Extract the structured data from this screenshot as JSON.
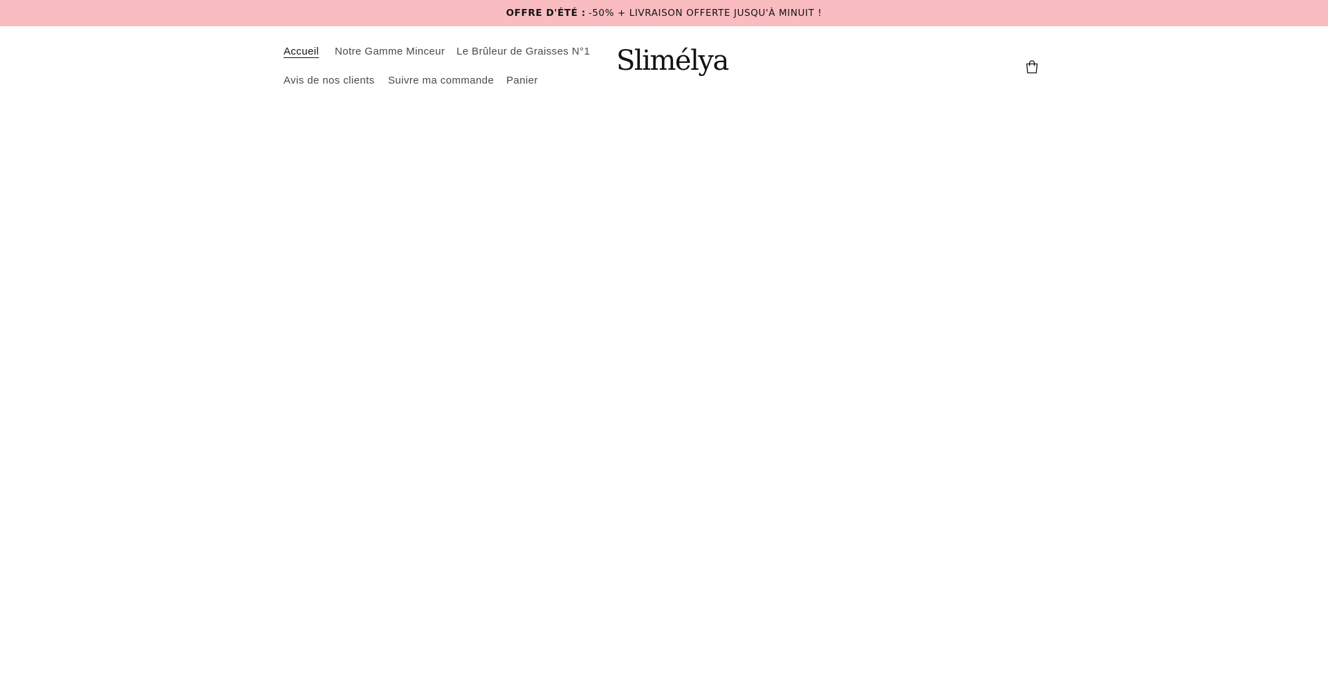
{
  "announcement": {
    "strong": "OFFRE D'ÉTÉ :",
    "text": "-50% + LIVRAISON OFFERTE JUSQU'À MINUIT !"
  },
  "nav": {
    "items": [
      {
        "label": "Accueil",
        "active": true
      },
      {
        "label": "Notre Gamme Minceur"
      },
      {
        "label": "Le Brûleur de Graisses N°1"
      },
      {
        "label": "Avis de nos clients"
      },
      {
        "label": "Suivre ma commande"
      },
      {
        "label": "Panier"
      }
    ]
  },
  "logo": {
    "text": "Slimélya"
  },
  "cart": {
    "icon": "cart-icon"
  },
  "colors": {
    "announcement_bg": "#f9bcc1",
    "text": "#121212"
  }
}
